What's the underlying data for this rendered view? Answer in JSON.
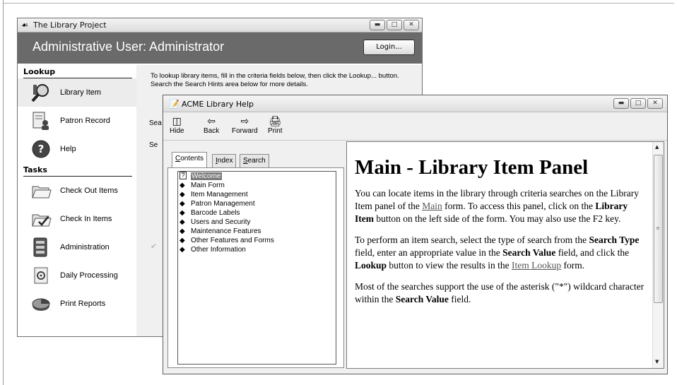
{
  "main_window": {
    "title": "The Library Project",
    "header_title": "Administrative User: Administrator",
    "login_label": "Login...",
    "lookup_heading": "Lookup",
    "lookup_items": [
      {
        "label": "Library Item",
        "icon": "magnifier-books-icon"
      },
      {
        "label": "Patron Record",
        "icon": "patron-card-icon"
      },
      {
        "label": "Help",
        "icon": "help-icon"
      }
    ],
    "tasks_heading": "Tasks",
    "task_items": [
      {
        "label": "Check Out Items",
        "icon": "folder-open-icon"
      },
      {
        "label": "Check In Items",
        "icon": "folder-check-icon"
      },
      {
        "label": "Administration",
        "icon": "administration-icon"
      },
      {
        "label": "Daily Processing",
        "icon": "daily-processing-icon"
      },
      {
        "label": "Print Reports",
        "icon": "pie-chart-icon"
      }
    ],
    "instructions": "To lookup library items, fill in the criteria fields below, then click the Lookup... button. Search the Search Hints area below for more details.",
    "field_label_1": "Sea",
    "field_label_2": "Se"
  },
  "help_window": {
    "title": "ACME Library Help",
    "toolbar": {
      "hide": "Hide",
      "back": "Back",
      "forward": "Forward",
      "print": "Print"
    },
    "tabs": {
      "contents_prefix": "",
      "contents_u": "C",
      "contents_rest": "ontents",
      "index_prefix": "",
      "index_u": "I",
      "index_rest": "ndex",
      "search_prefix": "",
      "search_u": "S",
      "search_rest": "earch"
    },
    "tree": [
      {
        "label": "Welcome",
        "icon": "help-page-icon",
        "selected": true
      },
      {
        "label": "Main Form",
        "icon": "book-icon"
      },
      {
        "label": "Item Management",
        "icon": "book-icon"
      },
      {
        "label": "Patron Management",
        "icon": "book-icon"
      },
      {
        "label": "Barcode Labels",
        "icon": "book-icon"
      },
      {
        "label": "Users and Security",
        "icon": "book-icon"
      },
      {
        "label": "Maintenance Features",
        "icon": "book-icon"
      },
      {
        "label": "Other Features and Forms",
        "icon": "book-icon"
      },
      {
        "label": "Other Information",
        "icon": "book-icon"
      }
    ],
    "doc": {
      "heading": "Main - Library Item Panel",
      "p1_a": "You can locate items in the library through criteria searches on the Library Item panel of the ",
      "p1_link": "Main",
      "p1_b": " form. To access this panel, click on the ",
      "p1_bold": "Library Item",
      "p1_c": " button on the left side of the form. You may also use the F2 key.",
      "p2_a": "To perform an item search, select the type of search from the ",
      "p2_bold1": "Search Type",
      "p2_b": " field, enter an appropriate value in the ",
      "p2_bold2": "Search Value",
      "p2_c": " field, and click the ",
      "p2_bold3": "Lookup",
      "p2_d": " button to view the results in the ",
      "p2_link": "Item Lookup",
      "p2_e": " form.",
      "p3_a": "Most of the searches support the use of the asterisk (\"*\") wildcard character within the ",
      "p3_bold": "Search Value",
      "p3_b": " field."
    }
  }
}
